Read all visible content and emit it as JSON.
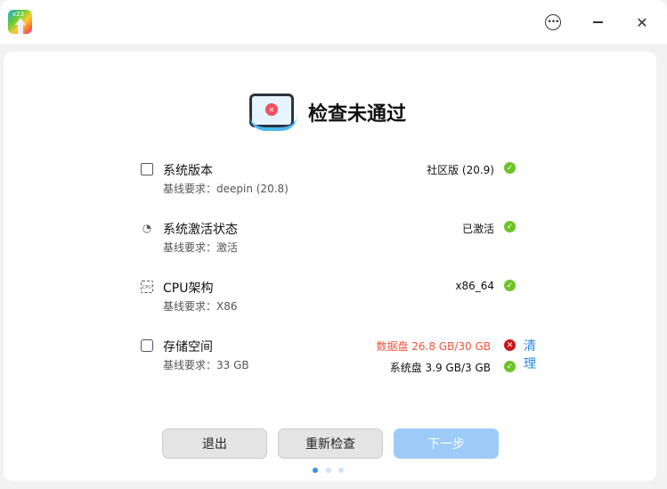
{
  "app": {
    "logo_text": "v23"
  },
  "window": {
    "more_icon": "more-icon",
    "minimize_icon": "minimize-icon",
    "close_icon": "close-icon"
  },
  "header": {
    "title": "检查未通过",
    "illustration": "monitor-error-icon"
  },
  "checks": [
    {
      "name": "系统版本",
      "requirement": "基线要求：deepin (20.8)",
      "value": "社区版 (20.9)",
      "status": "pass",
      "icon": "monitor-icon"
    },
    {
      "name": "系统激活状态",
      "requirement": "基线要求：激活",
      "value": "已激活",
      "status": "pass",
      "icon": "gauge-icon"
    },
    {
      "name": "CPU架构",
      "requirement": "基线要求：X86",
      "value": "x86_64",
      "status": "pass",
      "icon": "cpu-icon"
    },
    {
      "name": "存储空间",
      "requirement": "基线要求：33 GB",
      "value": "数据盘 26.8 GB/30 GB",
      "status": "fail",
      "action": "清理",
      "value2": "系统盘 3.9 GB/3 GB",
      "status2": "pass",
      "icon": "disk-icon"
    }
  ],
  "buttons": {
    "exit": "退出",
    "recheck": "重新检查",
    "next": "下一步"
  },
  "pagination": {
    "current": 1,
    "total": 3
  },
  "colors": {
    "pass": "#6cc426",
    "fail": "#c8171d",
    "fail_text": "#f0543c",
    "link": "#2a88e6",
    "primary": "#9ccbf7"
  }
}
